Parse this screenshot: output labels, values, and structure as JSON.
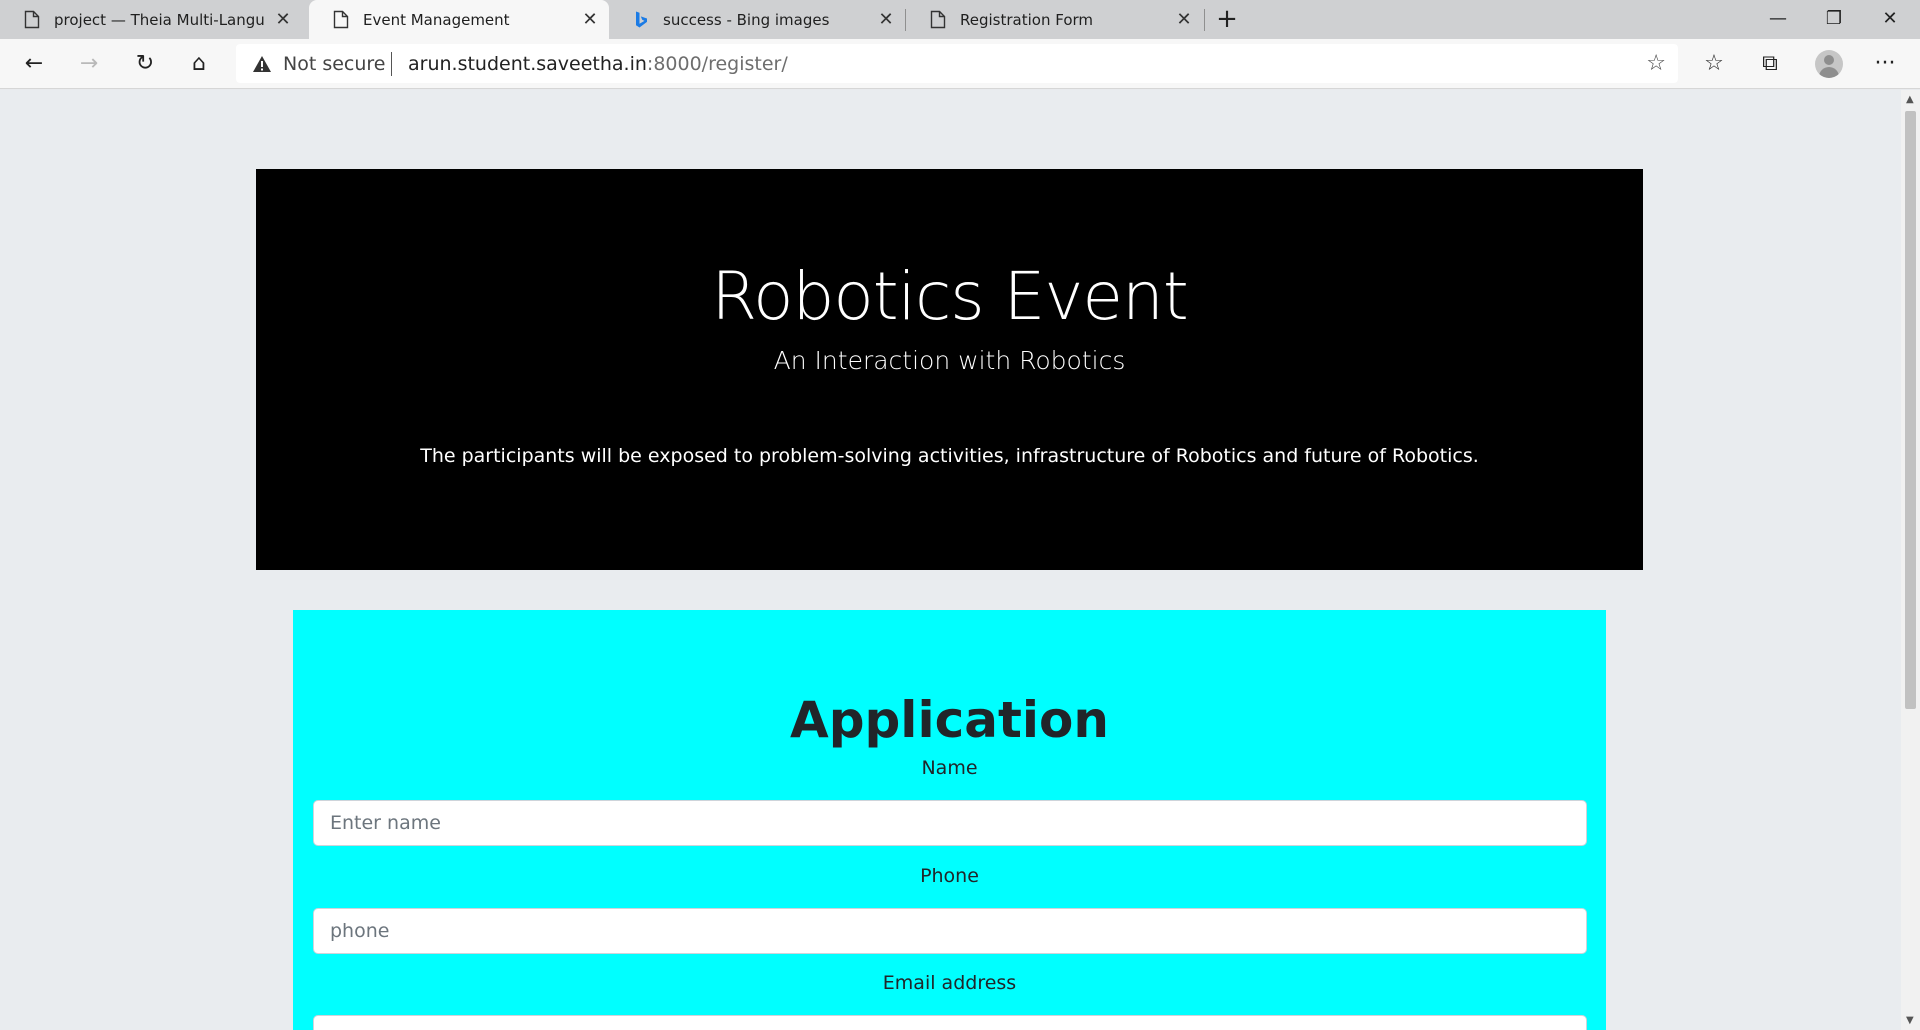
{
  "browser": {
    "tabs": [
      {
        "title": "project — Theia Multi-Language",
        "active": false
      },
      {
        "title": "Event Management",
        "active": true
      },
      {
        "title": "success - Bing images",
        "active": false
      },
      {
        "title": "Registration Form",
        "active": false
      }
    ],
    "security_label": "Not secure",
    "url_host": "arun.student.saveetha.in",
    "url_rest": ":8000/register/"
  },
  "hero": {
    "title": "Robotics Event",
    "subtitle": "An Interaction with Robotics",
    "description": "The participants will be exposed to problem-solving activities, infrastructure of Robotics and future of Robotics."
  },
  "form": {
    "heading": "Application",
    "fields": [
      {
        "label": "Name",
        "placeholder": "Enter name"
      },
      {
        "label": "Phone",
        "placeholder": "phone"
      },
      {
        "label": "Email address",
        "placeholder": ""
      }
    ]
  },
  "colors": {
    "hero_background": "#000000",
    "form_background": "#00ffff",
    "page_background": "#e9ecef"
  }
}
